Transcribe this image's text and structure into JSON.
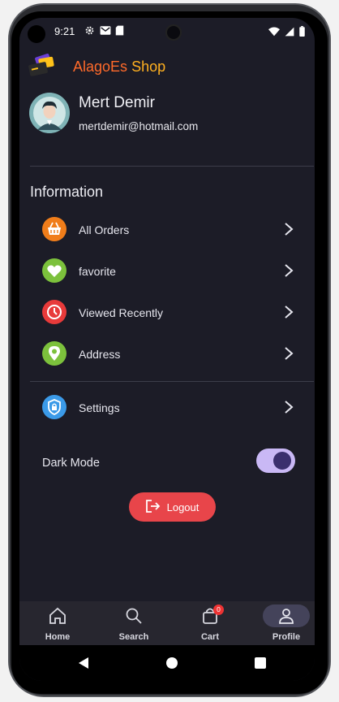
{
  "status": {
    "time": "9:21"
  },
  "header": {
    "brand_part1": "AlagoEs",
    "brand_part2": "Shop"
  },
  "profile": {
    "name": "Mert Demir",
    "email": "mertdemir@hotmail.com"
  },
  "information": {
    "title": "Information",
    "items": [
      {
        "label": "All Orders",
        "icon": "basket-icon",
        "color": "#f07d1a"
      },
      {
        "label": "favorite",
        "icon": "heart-icon",
        "color": "#7cc13c"
      },
      {
        "label": "Viewed Recently",
        "icon": "clock-icon",
        "color": "#e83a3a"
      },
      {
        "label": "Address",
        "icon": "location-pin-icon",
        "color": "#7cc13c"
      }
    ],
    "settings": {
      "label": "Settings",
      "icon": "shield-lock-icon",
      "color": "#3b9ae8"
    }
  },
  "dark_mode": {
    "label": "Dark Mode",
    "enabled": true
  },
  "logout": {
    "label": "Logout"
  },
  "bottom_nav": {
    "items": [
      {
        "label": "Home",
        "icon": "home-icon"
      },
      {
        "label": "Search",
        "icon": "search-icon"
      },
      {
        "label": "Cart",
        "icon": "cart-icon",
        "badge": "0"
      },
      {
        "label": "Profile",
        "icon": "person-icon",
        "active": true
      }
    ]
  }
}
